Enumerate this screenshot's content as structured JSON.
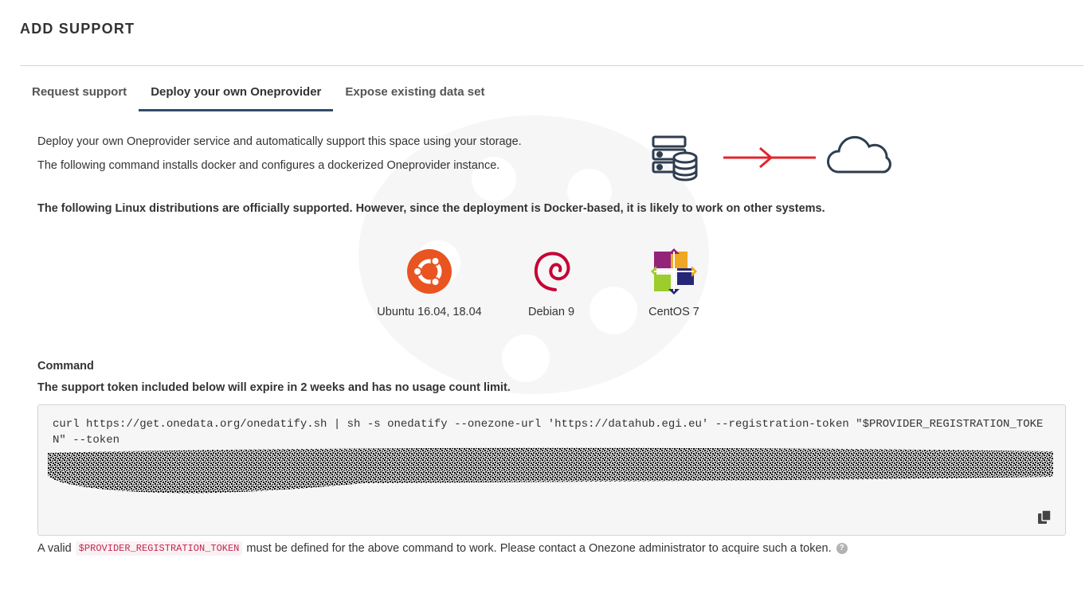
{
  "page": {
    "title": "ADD SUPPORT"
  },
  "tabs": [
    {
      "label": "Request support",
      "active": false
    },
    {
      "label": "Deploy your own Oneprovider",
      "active": true
    },
    {
      "label": "Expose existing data set",
      "active": false
    }
  ],
  "intro": {
    "line1": "Deploy your own Oneprovider service and automatically support this space using your storage.",
    "line2": "The following command installs docker and configures a dockerized Oneprovider instance."
  },
  "hero": {
    "icons": [
      "server-database-icon",
      "arrow-right-icon",
      "cloud-icon"
    ],
    "arrow_color": "#e0262d"
  },
  "supported_note": "The following Linux distributions are officially supported. However, since the deployment is Docker-based, it is likely to work on other systems.",
  "distros": [
    {
      "name": "Ubuntu 16.04, 18.04",
      "icon": "ubuntu-logo-icon",
      "color": "#e95420"
    },
    {
      "name": "Debian 9",
      "icon": "debian-logo-icon",
      "color": "#c70036"
    },
    {
      "name": "CentOS 7",
      "icon": "centos-logo-icon",
      "color": "#932279"
    }
  ],
  "command": {
    "heading": "Command",
    "subheading": "The support token included below will expire in 2 weeks and has no usage count limit.",
    "text": "curl https://get.onedata.org/onedatify.sh | sh -s onedatify --onezone-url 'https://datahub.egi.eu' --registration-token \"$PROVIDER_REGISTRATION_TOKEN\" --token",
    "copy_icon": "copy-icon"
  },
  "footer": {
    "prefix": "A valid",
    "code": "$PROVIDER_REGISTRATION_TOKEN",
    "suffix": "must be defined for the above command to work. Please contact a Onezone administrator to acquire such a token.",
    "help": "?"
  }
}
